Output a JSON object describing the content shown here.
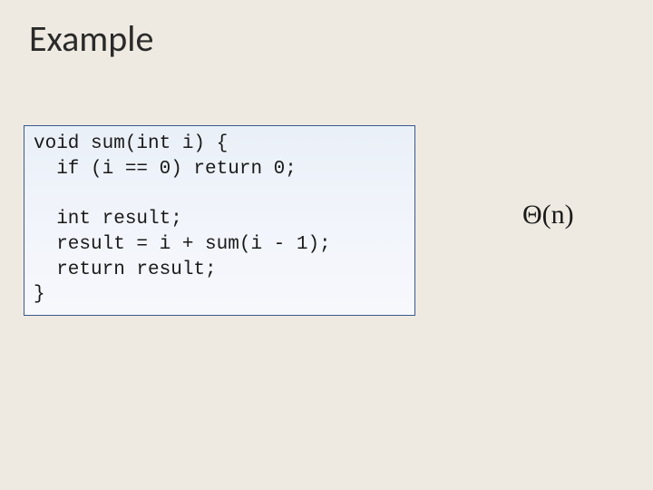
{
  "title": "Example",
  "code": "void sum(int i) {\n  if (i == 0) return 0;\n\n  int result;\n  result = i + sum(i - 1);\n  return result;\n}",
  "complexity": "Θ(n)"
}
